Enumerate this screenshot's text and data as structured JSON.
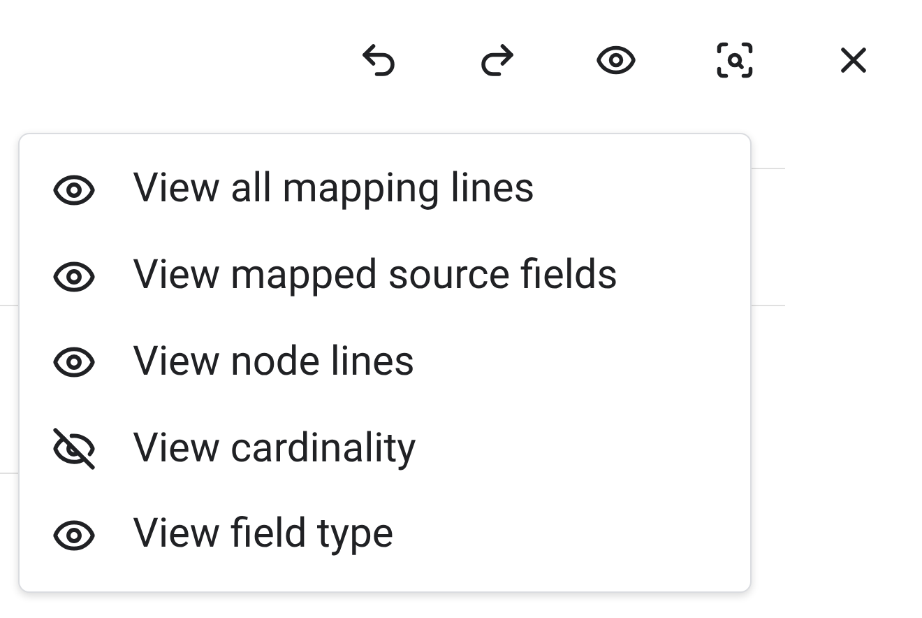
{
  "toolbar": [
    {
      "kind": "undo"
    },
    {
      "kind": "redo"
    },
    {
      "kind": "view"
    },
    {
      "kind": "focus"
    },
    {
      "kind": "close"
    }
  ],
  "menu": {
    "items": [
      {
        "label": "View all mapping lines",
        "visible": true
      },
      {
        "label": "View mapped source fields",
        "visible": true
      },
      {
        "label": "View node lines",
        "visible": true
      },
      {
        "label": "View cardinality",
        "visible": false
      },
      {
        "label": "View field type",
        "visible": true
      }
    ]
  }
}
